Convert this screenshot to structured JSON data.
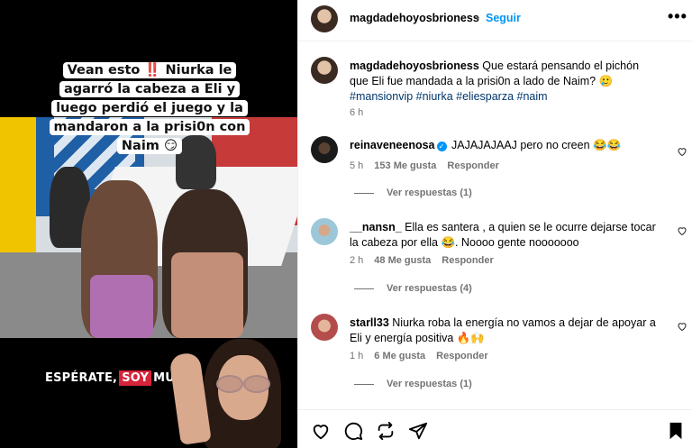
{
  "media": {
    "caption": "Vean esto ‼️ Niurka le agarró la cabeza a Eli y luego perdió el juego y la mandaron a la prisi0n con Naim 😏",
    "overlay_logo": {
      "left": "ESPÉRATE,",
      "highlight": "SOY",
      "right": "MUY"
    }
  },
  "header": {
    "username": "magdadehoyosbrioness",
    "separator": "•",
    "follow_label": "Seguir",
    "more_label": "•••"
  },
  "post": {
    "username": "magdadehoyosbrioness",
    "text": "Que estará pensando el pichón que Eli fue mandada a la prisi0n a lado de Naim? 🥲",
    "hashtags": "#mansionvip #niurka #eliesparza #naim",
    "time": "6 h"
  },
  "comments": [
    {
      "username": "reinaveneenosa",
      "verified": true,
      "text": "JAJAJAJAAJ pero no creen 😂😂",
      "time": "5 h",
      "likes": "153 Me gusta",
      "reply": "Responder",
      "view_replies": "Ver respuestas (1)"
    },
    {
      "username": "__nansn_",
      "verified": false,
      "text": "Ella es santera , a quien se le ocurre dejarse tocar la cabeza por ella 😂. Noooo gente nooooooo",
      "time": "2 h",
      "likes": "48 Me gusta",
      "reply": "Responder",
      "view_replies": "Ver respuestas (4)"
    },
    {
      "username": "starll33",
      "verified": false,
      "text": "Niurka roba la energía no vamos a dejar de apoyar a Eli y energía positiva 🔥🙌",
      "time": "1 h",
      "likes": "6 Me gusta",
      "reply": "Responder",
      "view_replies": "Ver respuestas (1)"
    }
  ],
  "icons": {
    "like": "heart-icon",
    "comment": "comment-icon",
    "repost": "repost-icon",
    "share": "share-icon",
    "save": "bookmark-icon",
    "more": "more-options-icon"
  },
  "colors": {
    "accent": "#0095f6",
    "hashtag": "#00376b",
    "secondary_text": "#737373",
    "logo_red": "#d6243a"
  }
}
